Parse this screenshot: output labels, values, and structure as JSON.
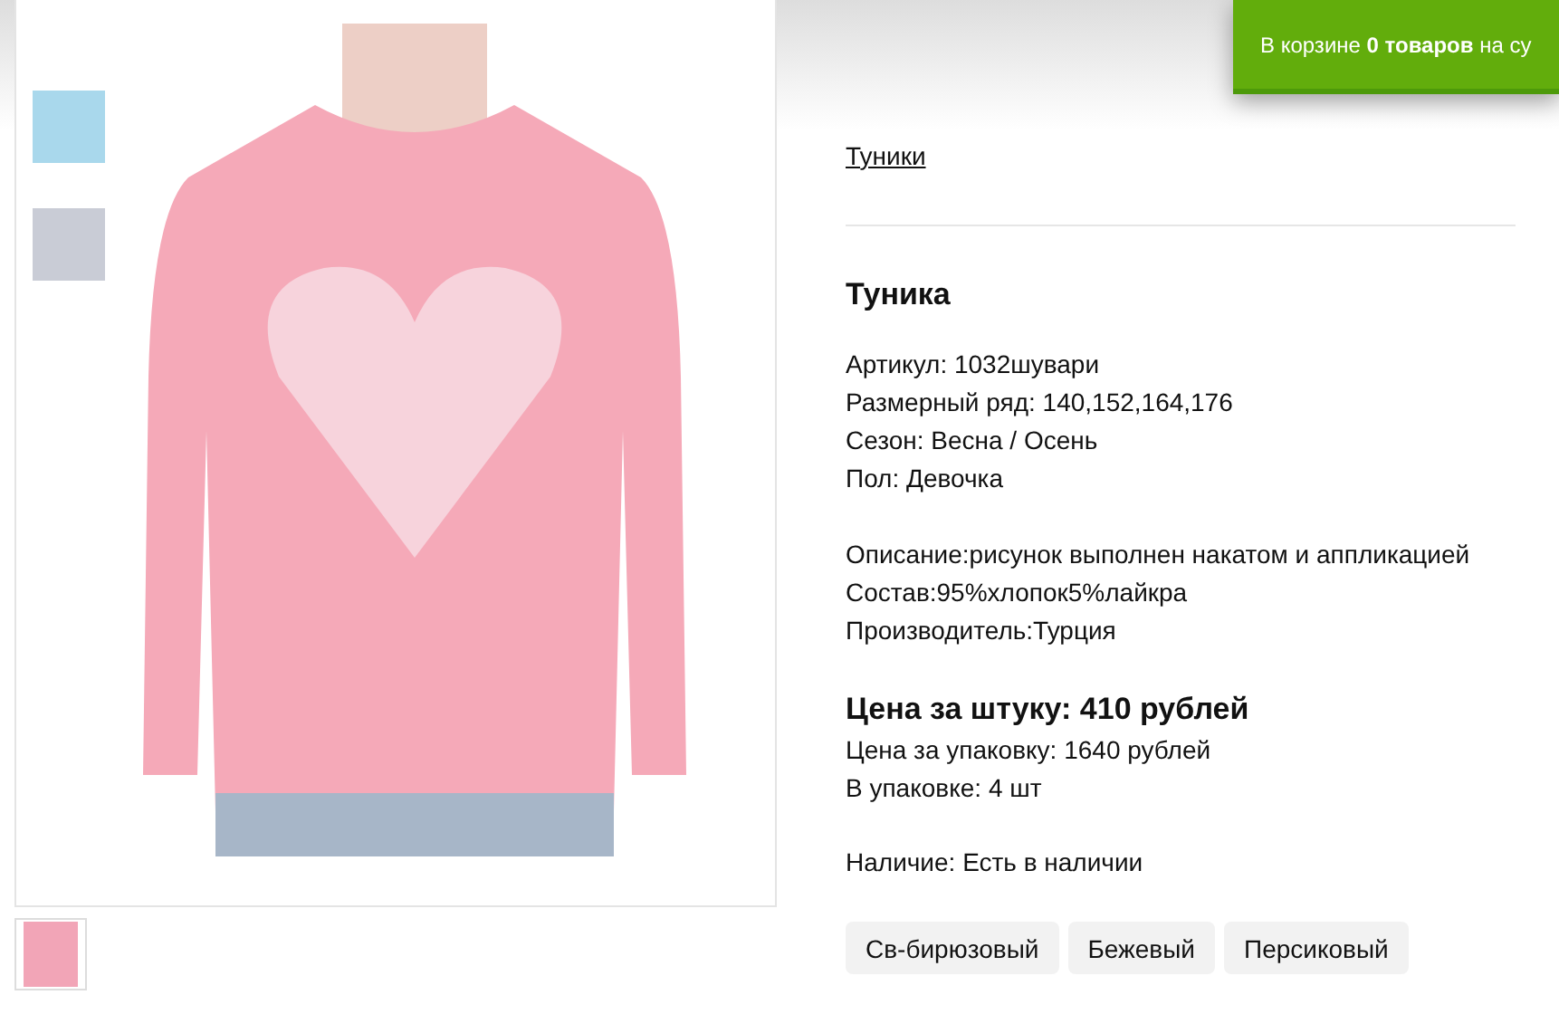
{
  "cart_banner": {
    "text": "В корзине **0 товаров** на су"
  },
  "gallery": {
    "side_thumbnails": [
      {
        "color": "#a9d8ec"
      },
      {
        "color": "#c9ccd6"
      }
    ],
    "bottom_thumbnails": [
      {
        "color": "#f2a5b7"
      }
    ]
  },
  "product": {
    "category_link": "Туники",
    "title": "Туника",
    "specs": [
      "Артикул: 1032шувари",
      "Размерный ряд: 140,152,164,176",
      "Сезон: Весна / Осень",
      "Пол: Девочка"
    ],
    "details": [
      "Описание:рисунок выполнен накатом и аппликацией",
      "Состав:95%хлопок5%лайкра",
      "Производитель:Турция"
    ],
    "price": "Цена за штуку: 410 рублей",
    "pack": [
      "Цена за упаковку: 1640 рублей",
      "В упаковке: 4 шт"
    ],
    "availability": "Наличие: Есть в наличии",
    "colors": [
      "Св-бирюзовый",
      "Бежевый",
      "Персиковый"
    ]
  }
}
